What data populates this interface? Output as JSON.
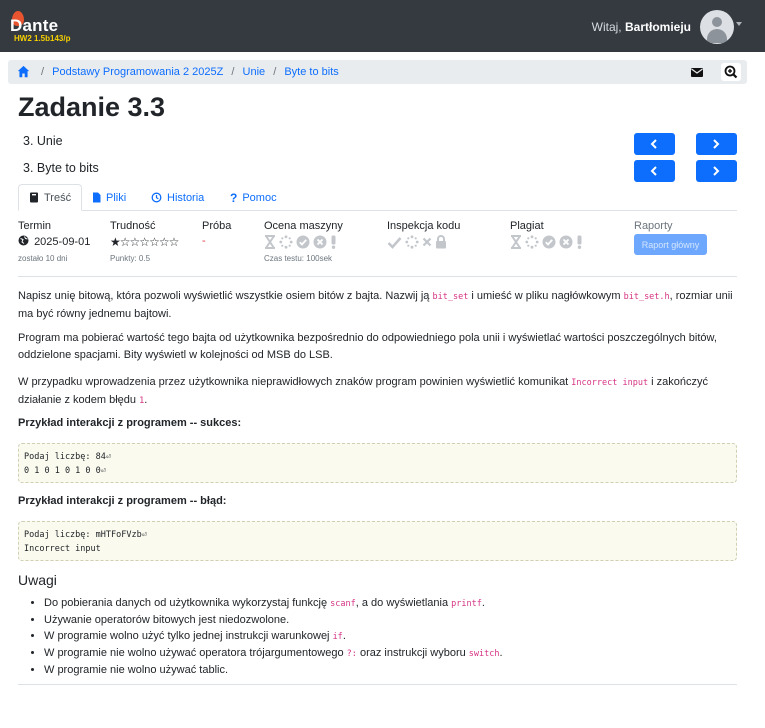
{
  "navbar": {
    "brand": "Dante",
    "brand_subtitle": "HW2 1.5b143/p",
    "welcome_prefix": "Witaj,",
    "user_name": "Bartłomieju"
  },
  "breadcrumb": {
    "items": [
      "Podstawy Programowania 2 2025Z",
      "Unie",
      "Byte to bits"
    ],
    "separator": "/"
  },
  "task": {
    "title": "Zadanie 3.3",
    "chapter": "3. Unie",
    "subtask": "3. Byte to bits"
  },
  "tabs": [
    {
      "label": "Treść",
      "icon": "book-icon",
      "active": true
    },
    {
      "label": "Pliki",
      "icon": "file-icon",
      "active": false
    },
    {
      "label": "Historia",
      "icon": "history-icon",
      "active": false
    },
    {
      "label": "Pomoc",
      "icon": "question-icon",
      "active": false
    }
  ],
  "status": {
    "deadline": {
      "label": "Termin",
      "date": "2025-09-01",
      "remaining": "zostało 10 dni"
    },
    "difficulty": {
      "label": "Trudność",
      "rating": 1,
      "max": 7,
      "points": "Punkty: 0.5"
    },
    "attempt": {
      "label": "Próba",
      "value": "-"
    },
    "machine": {
      "label": "Ocena maszyny",
      "test_time": "Czas testu: 100sek"
    },
    "inspection": {
      "label": "Inspekcja kodu"
    },
    "plagiarism": {
      "label": "Plagiat"
    },
    "reports": {
      "label": "Raporty",
      "button": "Raport główny"
    }
  },
  "content": {
    "p1_a": "Napisz unię bitową, która pozwoli wyświetlić wszystkie osiem bitów z bajta. Nazwij ją ",
    "p1_code1": "bit_set",
    "p1_b": " i umieść w pliku nagłówkowym ",
    "p1_code2": "bit_set.h",
    "p1_c": ", rozmiar unii ma być równy jednemu bajtowi.",
    "p2": "Program ma pobierać wartość tego bajta od użytkownika bezpośrednio do odpowiedniego pola unii i wyświetlać wartości poszczególnych bitów, oddzielone spacjami. Bity wyświetl w kolejności od MSB do LSB.",
    "p3_a": "W przypadku wprowadzenia przez użytkownika nieprawidłowych znaków program powinien wyświetlić komunikat ",
    "p3_code": "Incorrect input",
    "p3_b": " i zakończyć działanie z kodem błędu ",
    "p3_code2": "1",
    "p3_c": ".",
    "ex1_title": "Przykład interakcji z programem -- sukces:",
    "ex1_line1": "Podaj liczbę: 84⏎",
    "ex1_line2": "0 1 0 1 0 1 0 0⏎",
    "ex2_title": "Przykład interakcji z programem -- błąd:",
    "ex2_line1": "Podaj liczbę: mHTFoFVzb⏎",
    "ex2_line2": "Incorrect input",
    "notes_title": "Uwagi",
    "n1_a": "Do pobierania danych od użytkownika wykorzystaj funkcję ",
    "n1_code1": "scanf",
    "n1_b": ", a do wyświetlania ",
    "n1_code2": "printf",
    "n1_c": ".",
    "n2": "Używanie operatorów bitowych jest niedozwolone.",
    "n3_a": "W programie wolno użyć tylko jednej instrukcji warunkowej ",
    "n3_code": "if",
    "n3_b": ".",
    "n4_a": "W programie nie wolno używać operatora trójargumentowego ",
    "n4_code1": "?:",
    "n4_b": " oraz instrukcji wyboru ",
    "n4_code2": "switch",
    "n4_c": ".",
    "n5": "W programie nie wolno używać tablic."
  },
  "colors": {
    "navbar": "#343a40",
    "primary": "#0d6efd",
    "code": "#d63384",
    "brand_sub": "#f7d000"
  }
}
